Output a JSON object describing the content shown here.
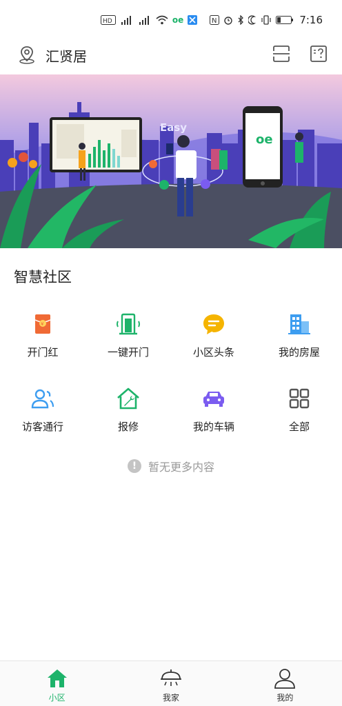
{
  "status_bar": {
    "left_icons": [
      "HD",
      "3G",
      "4G",
      "wifi",
      "oe",
      "bluetooth-app"
    ],
    "right_icons": [
      "nfc",
      "alarm",
      "bluetooth",
      "moon",
      "vibrate",
      "battery"
    ],
    "time": "7:16"
  },
  "header": {
    "title": "汇贤居",
    "location_icon": "location-pin-icon",
    "scan_icon": "scan-icon",
    "help_icon": "help-icon"
  },
  "banner": {
    "logo_text": "Easy",
    "brand_mark": "oe"
  },
  "section": {
    "title": "智慧社区"
  },
  "grid_items": [
    {
      "label": "开门红",
      "icon": "red-envelope-icon",
      "color": "#f06a35"
    },
    {
      "label": "一键开门",
      "icon": "door-open-icon",
      "color": "#1db36a"
    },
    {
      "label": "小区头条",
      "icon": "news-bubble-icon",
      "color": "#f5b400"
    },
    {
      "label": "我的房屋",
      "icon": "building-icon",
      "color": "#3d9df0"
    },
    {
      "label": "访客通行",
      "icon": "visitor-icon",
      "color": "#3d9df0"
    },
    {
      "label": "报修",
      "icon": "repair-house-icon",
      "color": "#1db36a"
    },
    {
      "label": "我的车辆",
      "icon": "car-icon",
      "color": "#7b5cf0"
    },
    {
      "label": "全部",
      "icon": "all-grid-icon",
      "color": "#555555"
    }
  ],
  "empty_hint": "暂无更多内容",
  "tabs": [
    {
      "label": "小区",
      "icon": "home-icon",
      "active": true
    },
    {
      "label": "我家",
      "icon": "smart-home-icon",
      "active": false
    },
    {
      "label": "我的",
      "icon": "user-icon",
      "active": false
    }
  ],
  "colors": {
    "accent": "#1db36a",
    "text": "#222222",
    "muted": "#9a9a9a"
  }
}
